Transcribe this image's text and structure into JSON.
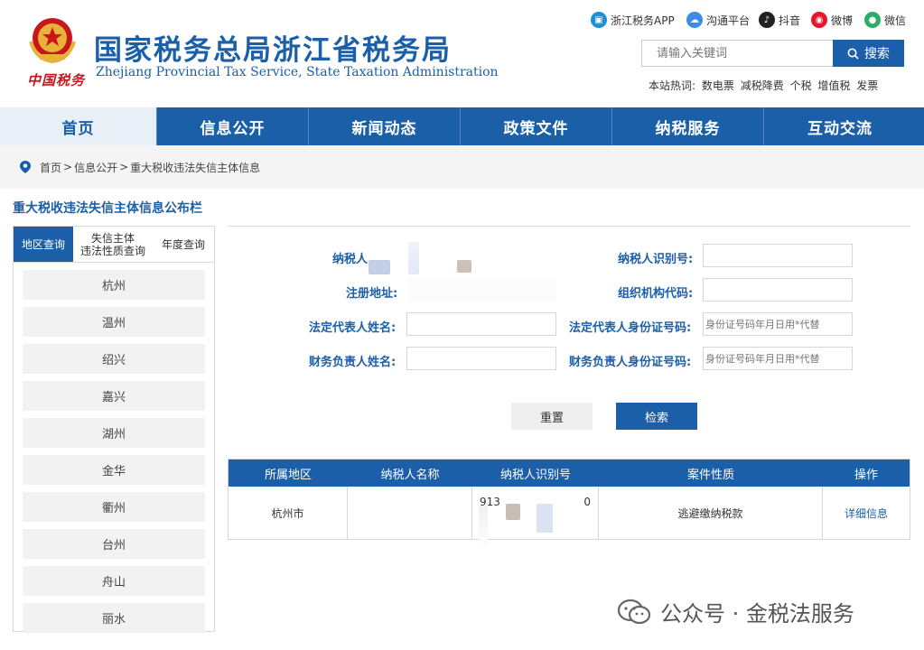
{
  "header": {
    "site_title": "国家税务总局浙江省税务局",
    "site_subtitle": "Zhejiang Provincial Tax Service, State Taxation Administration",
    "logo_text": "中国税务",
    "social": [
      {
        "label": "浙江税务APP",
        "icon": "app-icon",
        "color": "#1b8fd8"
      },
      {
        "label": "沟通平台",
        "icon": "cloud-icon",
        "color": "#3a8ee6"
      },
      {
        "label": "抖音",
        "icon": "douyin-icon",
        "color": "#222222"
      },
      {
        "label": "微博",
        "icon": "weibo-icon",
        "color": "#e6162d"
      },
      {
        "label": "微信",
        "icon": "wechat-icon",
        "color": "#2aae67"
      }
    ],
    "search_placeholder": "请输入关键词",
    "search_label": "搜索",
    "hot_label": "本站热词:",
    "hot_words": [
      "数电票",
      "减税降费",
      "个税",
      "增值税",
      "发票"
    ]
  },
  "nav": {
    "items": [
      "首页",
      "信息公开",
      "新闻动态",
      "政策文件",
      "纳税服务",
      "互动交流"
    ],
    "active": 0
  },
  "breadcrumb": {
    "items": [
      "首页",
      "信息公开",
      "重大税收违法失信主体信息"
    ],
    "separator": ">"
  },
  "sidebar": {
    "title": "重大税收违法失信主体信息公布栏",
    "tabs": [
      "地区查询",
      "失信主体\n违法性质查询",
      "年度查询"
    ],
    "regions": [
      "杭州",
      "温州",
      "绍兴",
      "嘉兴",
      "湖州",
      "金华",
      "衢州",
      "台州",
      "舟山",
      "丽水"
    ]
  },
  "form": {
    "labels": {
      "taxpayer_name": "纳税人",
      "taxpayer_id": "纳税人识别号:",
      "reg_address": "注册地址:",
      "org_code": "组织机构代码:",
      "legal_rep_name": "法定代表人姓名:",
      "legal_rep_id": "法定代表人身份证号码:",
      "fin_head_name": "财务负责人姓名:",
      "fin_head_id": "财务负责人身份证号码:"
    },
    "id_placeholder": "身份证号码年月日用*代替",
    "reset_label": "重置",
    "search_label": "检索"
  },
  "table": {
    "headers": [
      "所属地区",
      "纳税人名称",
      "纳税人识别号",
      "案件性质",
      "操作"
    ],
    "rows": [
      {
        "region": "杭州市",
        "name": "",
        "id_start": "913",
        "id_end": "0",
        "case_type": "逃避缴纳税款",
        "action": "详细信息"
      }
    ]
  },
  "watermark": {
    "text": "公众号 · 金税法服务"
  },
  "colors": {
    "brand": "#1b5fa8",
    "seal_red": "#c8161d"
  }
}
